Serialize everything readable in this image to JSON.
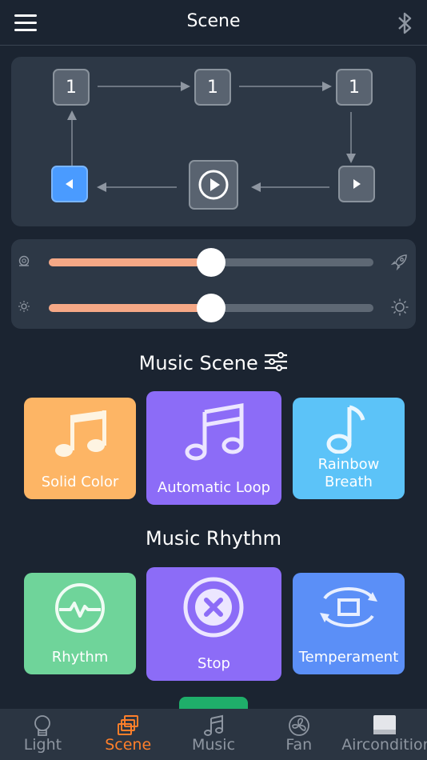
{
  "header": {
    "title": "Scene",
    "menu_icon": "menu-icon",
    "bluetooth_icon": "bluetooth-icon"
  },
  "sequence": {
    "top_row": [
      "1",
      "1",
      "1"
    ],
    "prev_icon": "left-triangle-icon",
    "play_icon": "play-circle-icon",
    "next_icon": "right-triangle-icon",
    "active_color": "#4a9bff"
  },
  "sliders": [
    {
      "name": "speed",
      "left_icon": "snail-icon",
      "right_icon": "rocket-icon",
      "value": 0.5
    },
    {
      "name": "brightness",
      "left_icon": "sun-small-icon",
      "right_icon": "sun-large-icon",
      "value": 0.5
    }
  ],
  "music_scene": {
    "title": "Music Scene",
    "settings_icon": "sliders-icon",
    "tiles": [
      {
        "label": "Solid Color",
        "icon": "music-note-icon",
        "color": "#fdb565"
      },
      {
        "label": "Automatic Loop",
        "icon": "music-notes-icon",
        "color": "#8c6cf7"
      },
      {
        "label": "Rainbow Breath",
        "icon": "single-note-icon",
        "color": "#5cc3f8"
      }
    ]
  },
  "music_rhythm": {
    "title": "Music Rhythm",
    "tiles": [
      {
        "label": "Rhythm",
        "icon": "pulse-icon",
        "color": "#6fd49a"
      },
      {
        "label": "Stop",
        "icon": "stop-x-icon",
        "color": "#8c6cf7"
      },
      {
        "label": "Temperament",
        "icon": "cycle-icon",
        "color": "#5b8ff7"
      }
    ]
  },
  "nav": {
    "items": [
      {
        "label": "Light",
        "icon": "bulb-icon"
      },
      {
        "label": "Scene",
        "icon": "layers-icon"
      },
      {
        "label": "Music",
        "icon": "music-icon"
      },
      {
        "label": "Fan",
        "icon": "fan-icon"
      },
      {
        "label": "Aircondition",
        "icon": "aircon-icon"
      }
    ],
    "active": "Scene",
    "active_color": "#ff7f2a"
  }
}
